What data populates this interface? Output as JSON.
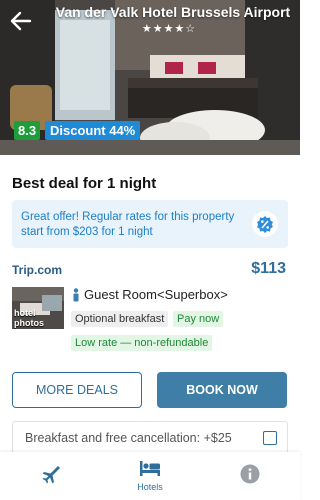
{
  "hero": {
    "hotel_name": "Van der Valk Hotel Brussels Airport",
    "stars": "★★★★☆",
    "rating": "8.3",
    "discount": "Discount 44%"
  },
  "deal": {
    "title": "Best deal for 1 night",
    "offer_line1": "Great offer! Regular rates for this property",
    "offer_line2": "start from $203 for 1 night"
  },
  "listing": {
    "provider": "Trip.com",
    "price": "$113",
    "thumb_label_line1": "hotel",
    "thumb_label_line2": "photos",
    "room_name": "Guest Room<Superbox>",
    "tags": {
      "breakfast": "Optional breakfast",
      "pay": "Pay now",
      "rate": "Low rate — non-refundable"
    }
  },
  "buttons": {
    "more_deals": "MORE DEALS",
    "book_now": "BOOK NOW"
  },
  "addon": {
    "label": "Breakfast and free cancellation: +$25"
  },
  "nav": {
    "hotels": "Hotels"
  },
  "colors": {
    "accent": "#2f6e9b",
    "rating_green": "#1f9d3a",
    "discount_blue": "#1f8ad6",
    "offer_text": "#1b7fc8"
  }
}
